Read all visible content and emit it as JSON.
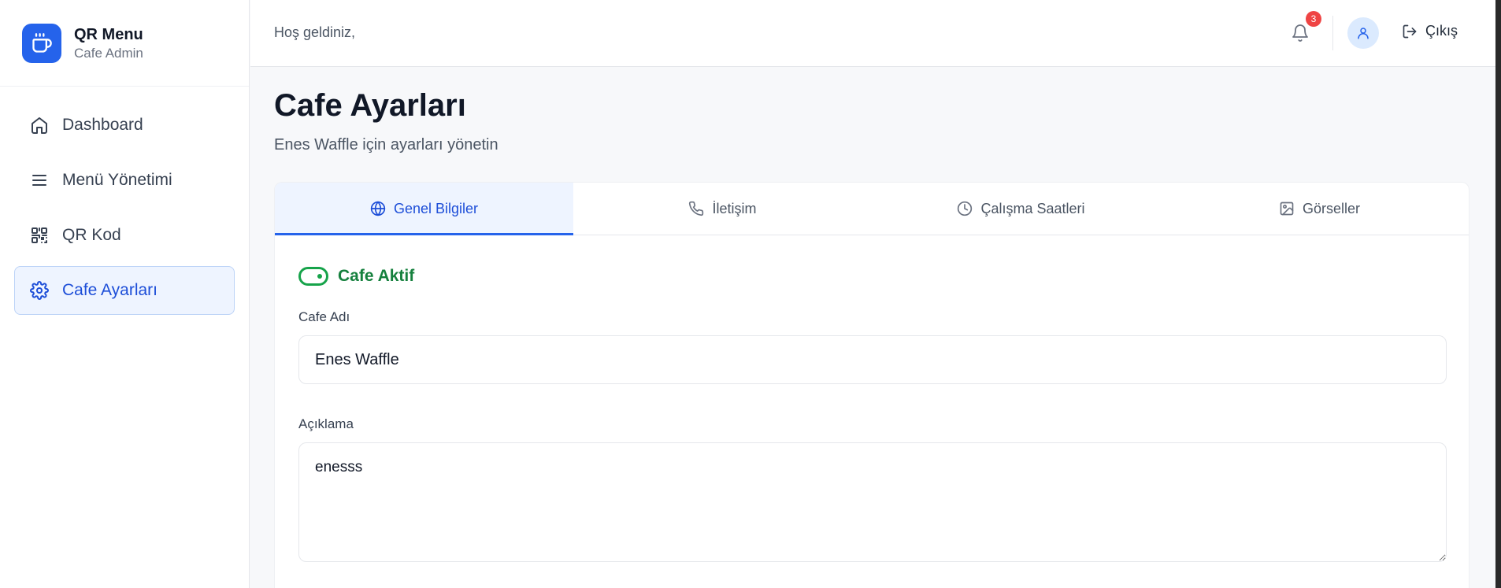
{
  "brand": {
    "title": "QR Menu",
    "subtitle": "Cafe Admin",
    "icon": "coffee-icon",
    "accent": "#2563eb"
  },
  "sidebar": {
    "items": [
      {
        "label": "Dashboard",
        "icon": "home-icon",
        "active": false
      },
      {
        "label": "Menü Yönetimi",
        "icon": "menu-icon",
        "active": false
      },
      {
        "label": "QR Kod",
        "icon": "qr-code-icon",
        "active": false
      },
      {
        "label": "Cafe Ayarları",
        "icon": "gear-icon",
        "active": true
      }
    ]
  },
  "topbar": {
    "welcome": "Hoş geldiniz,",
    "notification_count": "3",
    "logout_label": "Çıkış"
  },
  "page": {
    "title": "Cafe Ayarları",
    "subtitle": "Enes Waffle için ayarları yönetin"
  },
  "tabs": [
    {
      "label": "Genel Bilgiler",
      "icon": "globe-icon",
      "active": true
    },
    {
      "label": "İletişim",
      "icon": "phone-icon",
      "active": false
    },
    {
      "label": "Çalışma Saatleri",
      "icon": "clock-icon",
      "active": false
    },
    {
      "label": "Görseller",
      "icon": "image-icon",
      "active": false
    }
  ],
  "form": {
    "status_label": "Cafe Aktif",
    "status_active": true,
    "name_label": "Cafe Adı",
    "name_value": "Enes Waffle",
    "description_label": "Açıklama",
    "description_value": "enesss"
  },
  "colors": {
    "primary": "#2563eb",
    "success": "#16a34a",
    "badge": "#ef4444"
  }
}
